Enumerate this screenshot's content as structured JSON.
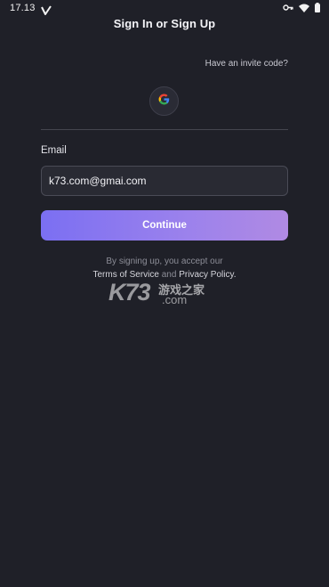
{
  "status_bar": {
    "time": "17.13",
    "icons": [
      "app-v-icon",
      "vpn-key-icon",
      "wifi-icon",
      "battery-icon"
    ]
  },
  "header": {
    "title": "Sign In or Sign Up"
  },
  "invite": {
    "label": "Have an invite code?"
  },
  "google": {
    "icon": "google-g-icon",
    "colors": {
      "blue": "#4285F4",
      "red": "#EA4335",
      "yellow": "#FBBC05",
      "green": "#34A853"
    }
  },
  "email": {
    "label": "Email",
    "value": "k73.com@gmai.com"
  },
  "continue": {
    "label": "Continue",
    "gradient_start": "#7b6ff2",
    "gradient_end": "#b08ae3"
  },
  "terms": {
    "line1": "By signing up, you accept our",
    "terms_link": "Terms of Service",
    "and_text": "and",
    "privacy_link": "Privacy Policy",
    "end": "."
  },
  "watermark": {
    "brand": "K73",
    "chinese": "游戏之家",
    "domain": ".com"
  },
  "colors": {
    "background": "#1f2028",
    "field_bg": "#292a33",
    "divider": "#45464f"
  }
}
